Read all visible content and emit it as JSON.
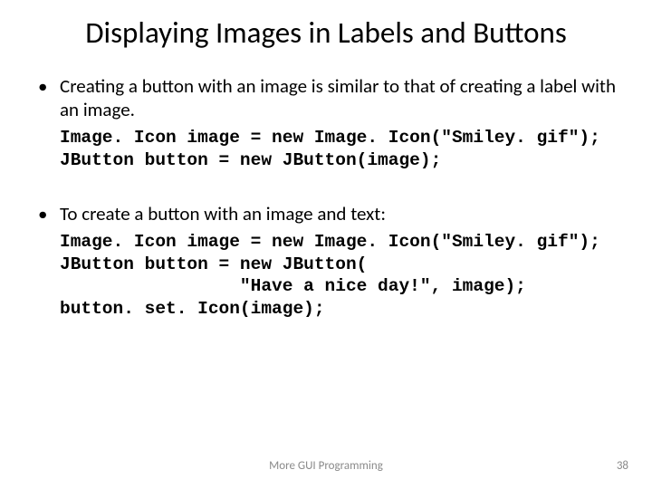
{
  "title": "Displaying Images in Labels and Buttons",
  "bullets": [
    "Creating a button with an image is similar to that of creating a label with an image.",
    "To create a button with an image and text:"
  ],
  "code1": "Image. Icon image = new Image. Icon(\"Smiley. gif\");\nJButton button = new JButton(image);",
  "code2": "Image. Icon image = new Image. Icon(\"Smiley. gif\");\nJButton button = new JButton(\n                 \"Have a nice day!\", image);\nbutton. set. Icon(image);",
  "footer": {
    "center": "More GUI Programming",
    "page": "38"
  }
}
